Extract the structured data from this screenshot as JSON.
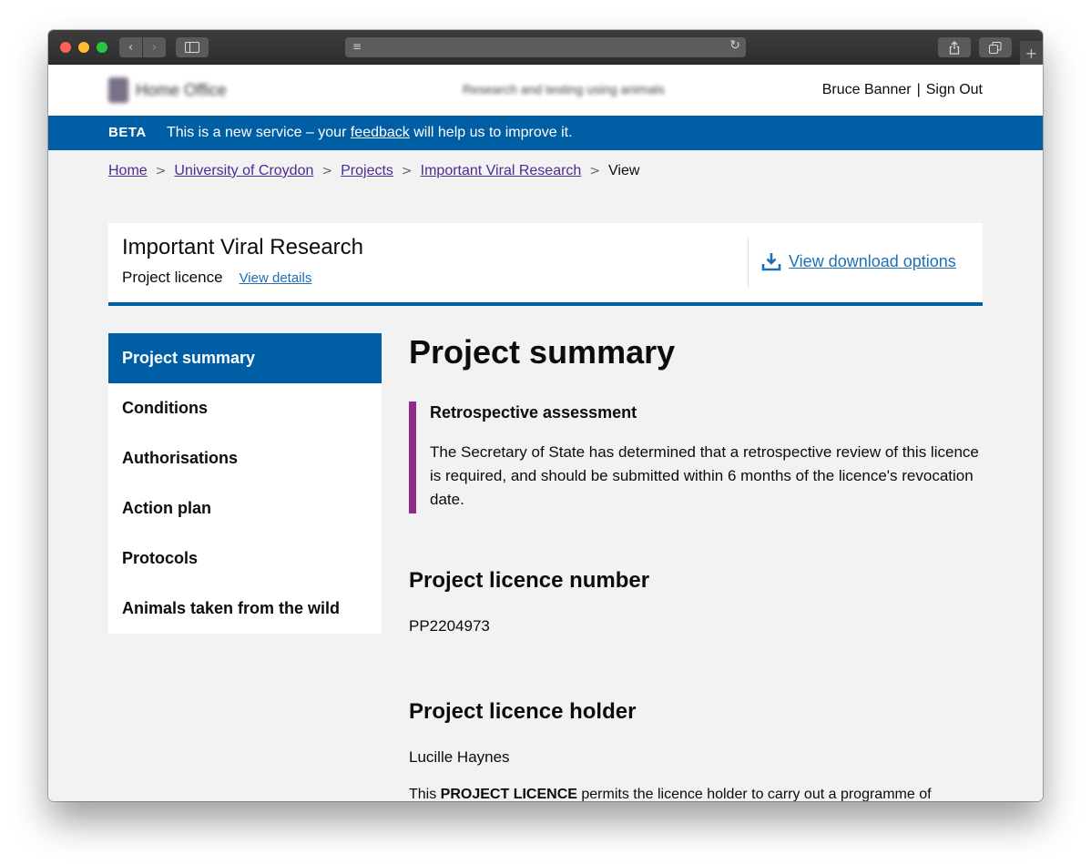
{
  "browser": {
    "back_icon": "‹",
    "forward_icon": "›",
    "reader_icon": "≡",
    "reload_icon": "↻",
    "new_tab_icon": "+"
  },
  "header": {
    "logo_text": "Home Office",
    "service_name": "Research and testing using animals",
    "user_name": "Bruce Banner",
    "separator": "|",
    "sign_out": "Sign Out"
  },
  "beta_banner": {
    "tag": "BETA",
    "text_before": "This is a new service – your ",
    "link": "feedback",
    "text_after": " will help us to improve it."
  },
  "breadcrumbs": [
    "Home",
    "University of Croydon",
    "Projects",
    "Important Viral Research",
    "View"
  ],
  "licence_header": {
    "title": "Important Viral Research",
    "subtitle": "Project licence",
    "details_link": "View details",
    "download_link": "View download options"
  },
  "sidenav": {
    "items": [
      "Project summary",
      "Conditions",
      "Authorisations",
      "Action plan",
      "Protocols",
      "Animals taken from the wild"
    ],
    "active": "Project summary"
  },
  "content": {
    "heading": "Project summary",
    "callout": {
      "title": "Retrospective assessment",
      "text": "The Secretary of State has determined that a retrospective review of this licence is required, and should be submitted within 6 months of the licence's revocation date."
    },
    "licence_number_label": "Project licence number",
    "licence_number": "PP2204973",
    "holder_label": "Project licence holder",
    "holder": "Lucille Haynes",
    "desc_prefix": "This ",
    "desc_bold": "PROJECT LICENCE",
    "desc_rest": " permits the licence holder to carry out a programme of"
  },
  "colors": {
    "brand_blue": "#005ea5",
    "link_blue": "#1d70b8",
    "visited_link": "#4c2c92",
    "callout_border": "#912b88"
  }
}
